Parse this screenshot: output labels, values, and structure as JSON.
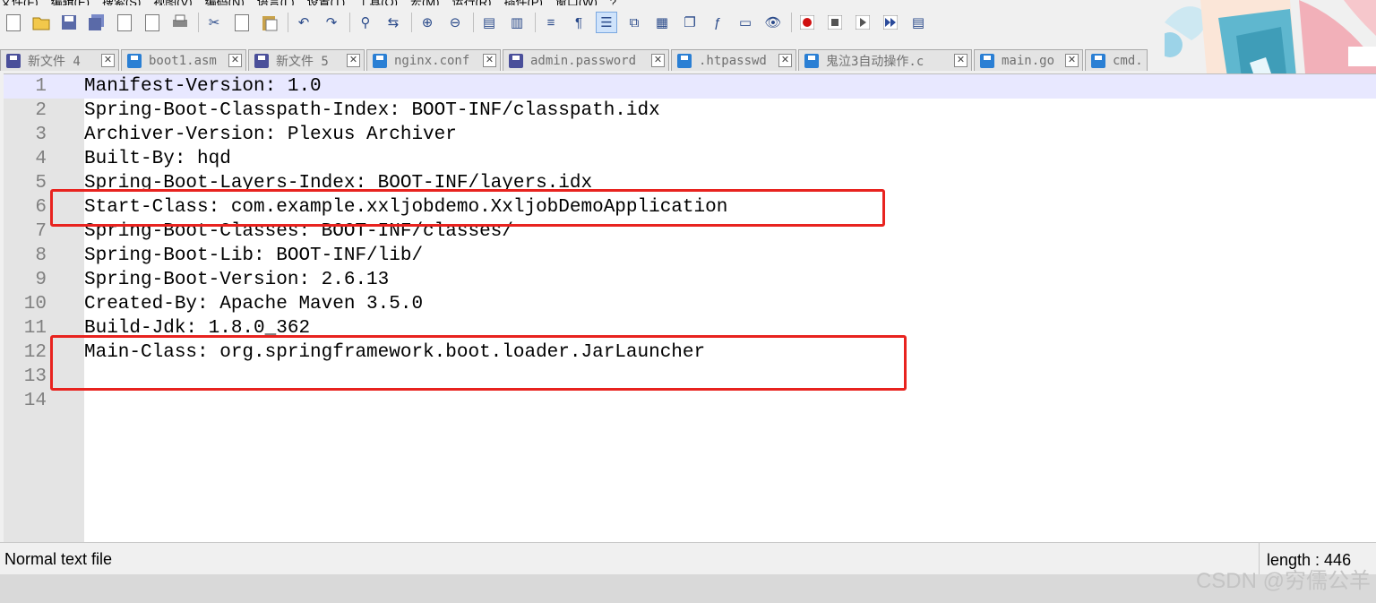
{
  "menu": [
    "文件(F)",
    "编辑(E)",
    "搜索(S)",
    "视图(V)",
    "编码(N)",
    "语言(L)",
    "设置(T)",
    "工具(O)",
    "宏(M)",
    "运行(R)",
    "插件(P)",
    "窗口(W)",
    "?"
  ],
  "tabs": [
    {
      "label": "新文件 4",
      "disk_color": "#4a4f9a"
    },
    {
      "label": "boot1.asm",
      "disk_color": "#2a7fd4"
    },
    {
      "label": "新文件 5",
      "disk_color": "#4a4f9a"
    },
    {
      "label": "nginx.conf",
      "disk_color": "#2a7fd4"
    },
    {
      "label": "admin.password",
      "disk_color": "#4a4f9a"
    },
    {
      "label": ".htpasswd",
      "disk_color": "#2a7fd4"
    },
    {
      "label": "鬼泣3自动操作.c",
      "disk_color": "#2a7fd4"
    },
    {
      "label": "main.go",
      "disk_color": "#2a7fd4"
    },
    {
      "label": "cmd.g",
      "disk_color": "#2a7fd4"
    }
  ],
  "lines": [
    {
      "n": "1",
      "text": "Manifest-Version: 1.0"
    },
    {
      "n": "2",
      "text": "Spring-Boot-Classpath-Index: BOOT-INF/classpath.idx"
    },
    {
      "n": "3",
      "text": "Archiver-Version: Plexus Archiver"
    },
    {
      "n": "4",
      "text": "Built-By: hqd"
    },
    {
      "n": "5",
      "text": "Spring-Boot-Layers-Index: BOOT-INF/layers.idx"
    },
    {
      "n": "6",
      "text": "Start-Class: com.example.xxljobdemo.XxljobDemoApplication"
    },
    {
      "n": "7",
      "text": "Spring-Boot-Classes: BOOT-INF/classes/"
    },
    {
      "n": "8",
      "text": "Spring-Boot-Lib: BOOT-INF/lib/"
    },
    {
      "n": "9",
      "text": "Spring-Boot-Version: 2.6.13"
    },
    {
      "n": "10",
      "text": "Created-By: Apache Maven 3.5.0"
    },
    {
      "n": "11",
      "text": "Build-Jdk: 1.8.0_362"
    },
    {
      "n": "12",
      "text": "Main-Class: org.springframework.boot.loader.JarLauncher"
    },
    {
      "n": "13",
      "text": ""
    },
    {
      "n": "14",
      "text": ""
    }
  ],
  "status": {
    "file_type": "Normal text file",
    "length": "length : 446"
  },
  "watermark": "CSDN @穷儒公羊",
  "colors": {
    "highlight_box": "#e8231f",
    "current_line": "#e8e8ff",
    "gutter": "#e4e4e4"
  }
}
